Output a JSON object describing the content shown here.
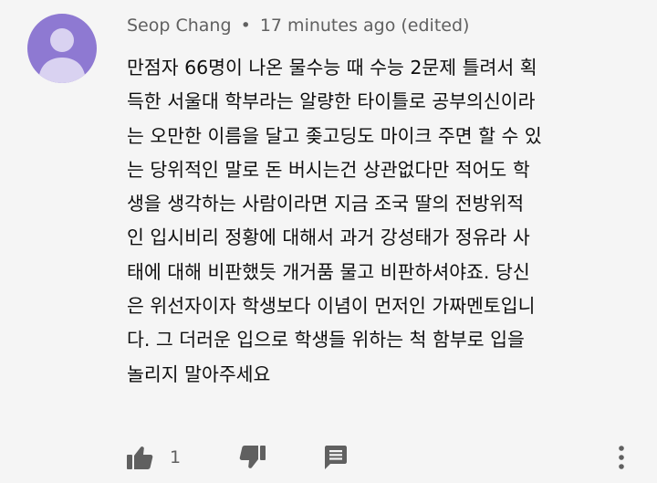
{
  "comment": {
    "author": "Seop Chang",
    "separator": "•",
    "timestamp": "17 minutes ago (edited)",
    "text_lines": [
      "만점자 66명이 나온 물수능 때 수능 2문제 틀려서 획",
      "득한 서울대 학부라는 알량한 타이틀로 공부의신이라",
      "는 오만한 이름을 달고 좆고딩도 마이크 주면 할 수 있",
      "는 당위적인 말로 돈 버시는건 상관없다만 적어도 학",
      "생을 생각하는 사람이라면 지금 조국 딸의 전방위적",
      "인 입시비리 정황에 대해서 과거 강성태가 정유라 사",
      "태에 대해 비판했듯 개거품 물고 비판하셔야죠. 당신",
      "은 위선자이자 학생보다 이념이 먼저인 가짜멘토입니",
      "다. 그 더러운 입으로 학생들 위하는 척 함부로 입을",
      "놀리지 말아주세요"
    ]
  },
  "actions": {
    "like_icon": "thumbs-up-icon",
    "like_count": "1",
    "dislike_icon": "thumbs-down-icon",
    "reply_icon": "comment-icon",
    "more_icon": "more-vert-icon"
  },
  "colors": {
    "background": "#f5f5f5",
    "avatar_bg": "#8e79d2",
    "avatar_fg": "#d9d2f1",
    "meta_text": "#606060",
    "body_text": "#0f0f0f",
    "icon": "#606060"
  }
}
